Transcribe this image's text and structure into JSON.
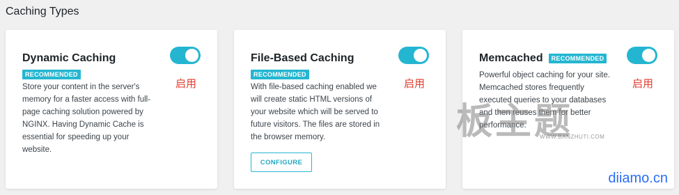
{
  "section": {
    "title": "Caching Types"
  },
  "cards": [
    {
      "title": "Dynamic Caching",
      "badge": "RECOMMENDED",
      "description": "Store your content in the server's memory for a faster access with full-page caching solution powered by NGINX. Having Dynamic Cache is essential for speeding up your website.",
      "enabled": true,
      "enabled_label": "启用"
    },
    {
      "title": "File-Based Caching",
      "badge": "RECOMMENDED",
      "description": "With file-based caching enabled we will create static HTML versions of your website which will be served to future visitors. The files are stored in the browser memory.",
      "enabled": true,
      "enabled_label": "启用",
      "button_label": "CONFIGURE"
    },
    {
      "title": "Memcached",
      "badge": "RECOMMENDED",
      "description": "Powerful object caching for your site. Memcached stores frequently executed queries to your databases and then reuses them for better performance.",
      "enabled": true,
      "enabled_label": "启用"
    }
  ],
  "watermark": {
    "text": "板主题",
    "url": "WWW.BANZHUTI.COM",
    "site": "diiamo.cn"
  },
  "colors": {
    "accent": "#24b6d1",
    "enabled_text": "#e23a2e",
    "background": "#f0f0f1",
    "card": "#ffffff",
    "site_watermark": "#2a6df4"
  }
}
